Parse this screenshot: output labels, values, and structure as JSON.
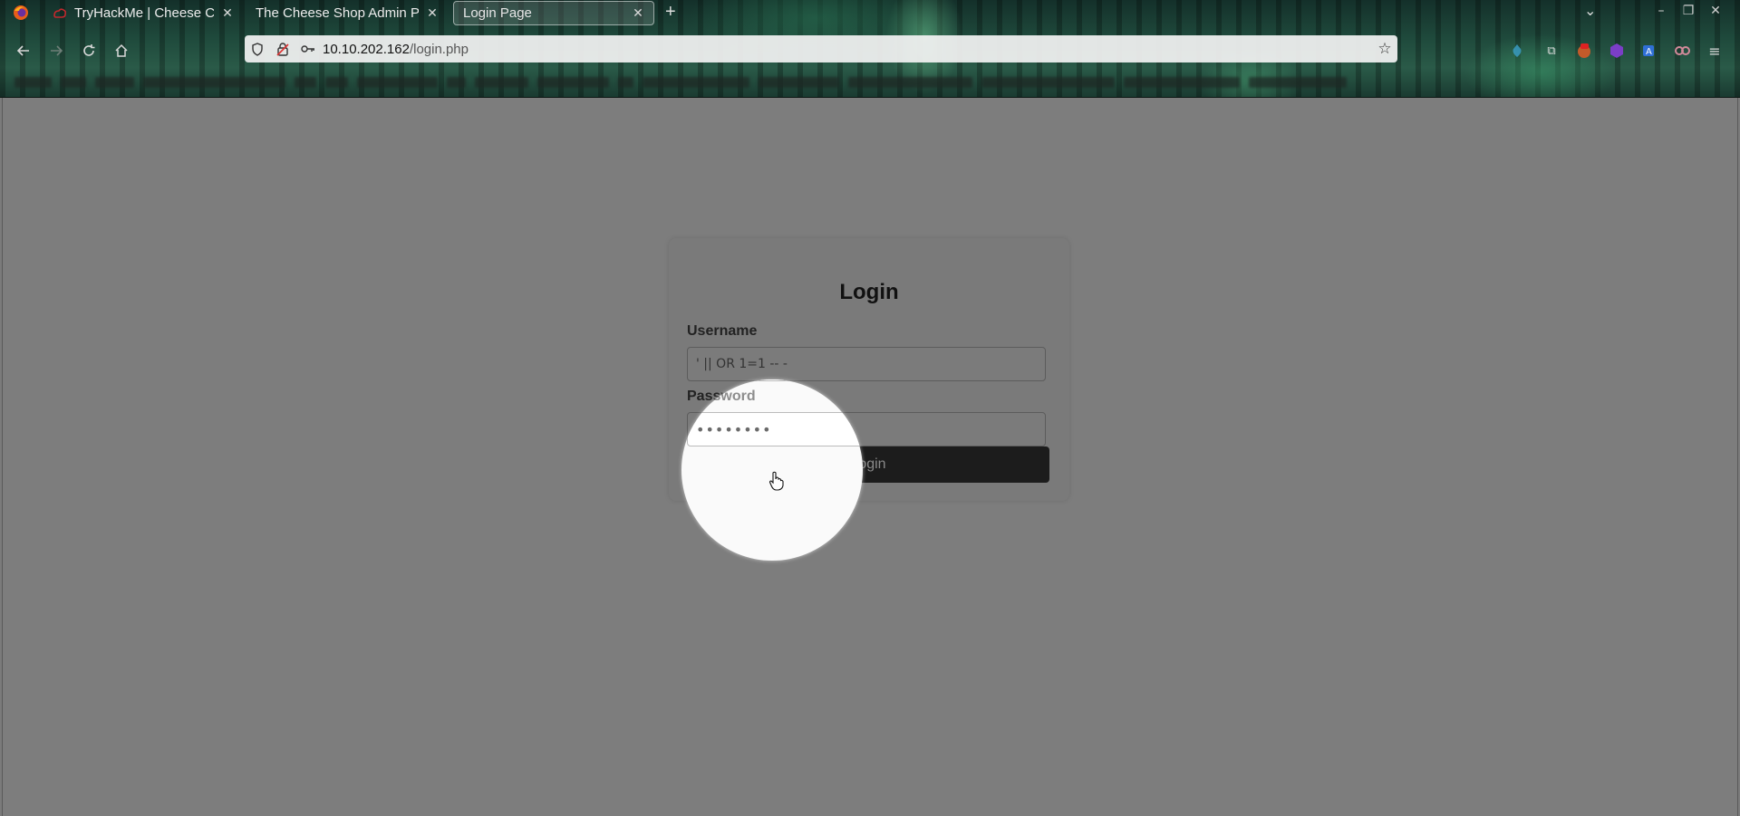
{
  "browser": {
    "tabs": [
      {
        "title": "TryHackMe | Cheese CTF",
        "active": false
      },
      {
        "title": "The Cheese Shop Admin Pan",
        "active": false
      },
      {
        "title": "Login Page",
        "active": true
      }
    ],
    "new_tab_symbol": "+",
    "url": {
      "host": "10.10.202.162",
      "path": "/login.php"
    },
    "extensions": [
      "extension-icon-1",
      "extension-icon-2",
      "extension-icon-3",
      "extension-icon-4",
      "extension-icon-5",
      "extension-icon-6"
    ]
  },
  "login": {
    "title": "Login",
    "username_label": "Username",
    "username_value": "' || OR 1=1 -- -",
    "password_label": "Password",
    "password_value": "••••••••",
    "submit_label": "Login"
  },
  "colors": {
    "page_overlay": "#7d7d7d",
    "button_bg": "#1c1c1c",
    "spotlight": "#fafafa"
  }
}
